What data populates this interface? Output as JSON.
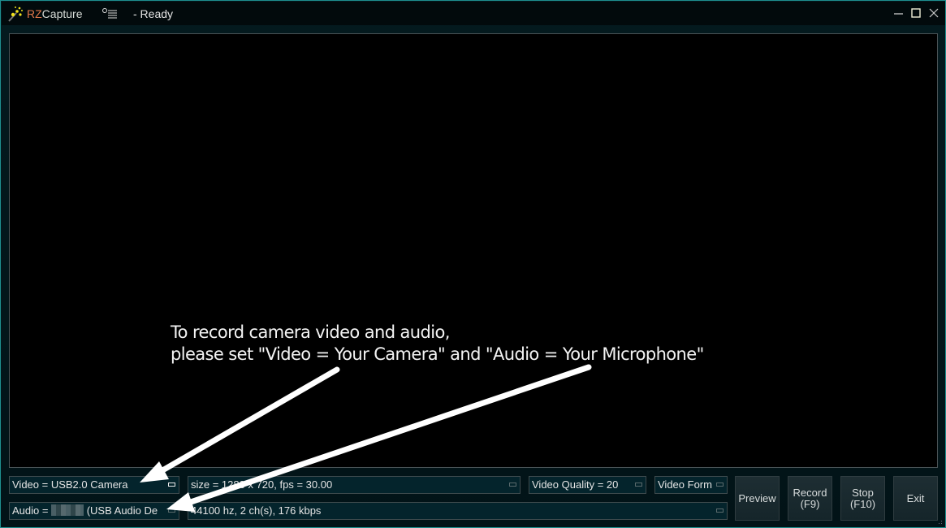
{
  "titlebar": {
    "app_name_prefix": "RZ",
    "app_name_rest": "Capture",
    "status": "- Ready",
    "icons": {
      "app": "magic-wand-icon",
      "menu": "settings-list-icon",
      "minimize": "minimize-icon",
      "maximize": "maximize-icon",
      "close": "close-icon"
    }
  },
  "instruction": {
    "line1": "To record camera video and audio,",
    "line2": "please set \"Video = Your Camera\" and \"Audio = Your Microphone\""
  },
  "controls": {
    "video_device": "Video = USB2.0 Camera",
    "audio_device_prefix": "Audio = ",
    "audio_device_suffix": " (USB Audio De",
    "video_format": "size = 1280 x 720, fps = 30.00",
    "audio_format": "44100 hz, 2 ch(s), 176 kbps",
    "video_quality": "Video Quality = 20",
    "video_format_select": "Video Form"
  },
  "buttons": {
    "preview": "Preview",
    "record_line1": "Record",
    "record_line2": "(F9)",
    "stop_line1": "Stop",
    "stop_line2": "(F10)",
    "exit": "Exit"
  },
  "colors": {
    "accent_border": "#1e8f8f",
    "title_brand": "#e2784a",
    "control_bg": "#04242c"
  }
}
